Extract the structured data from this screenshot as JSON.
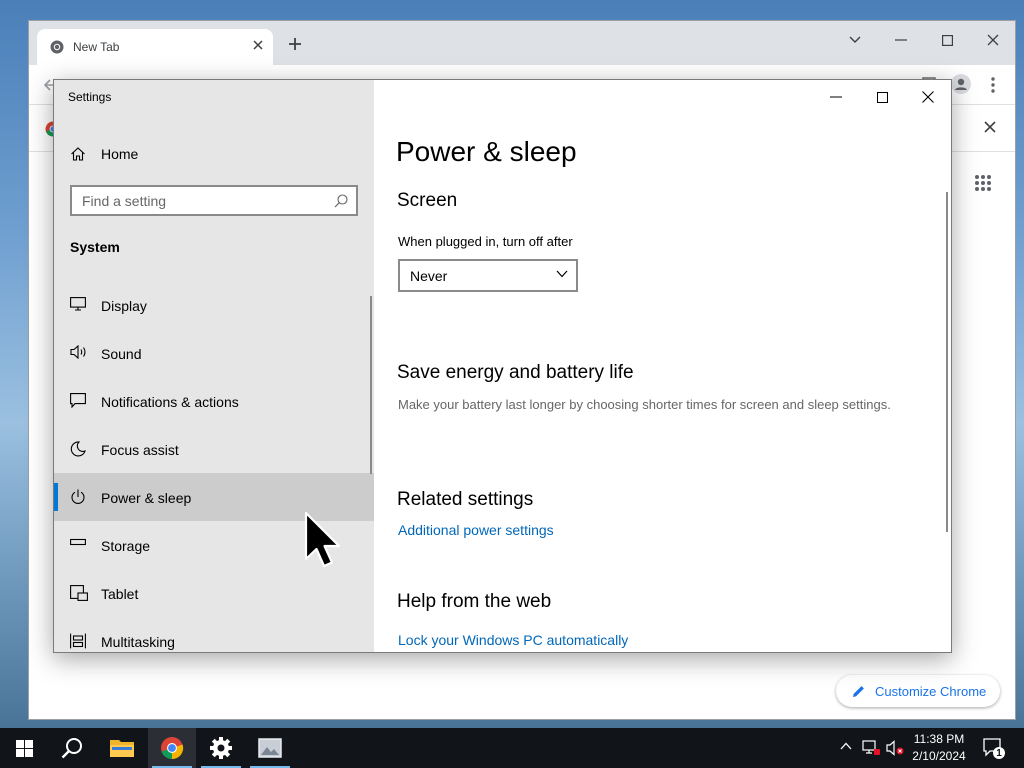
{
  "chrome": {
    "tab_title": "New Tab",
    "customize_label": "Customize Chrome"
  },
  "settings": {
    "window_title": "Settings",
    "home_label": "Home",
    "search_placeholder": "Find a setting",
    "category_heading": "System",
    "nav_items": [
      {
        "label": "Display",
        "icon": "monitor-icon"
      },
      {
        "label": "Sound",
        "icon": "speaker-icon"
      },
      {
        "label": "Notifications & actions",
        "icon": "notification-icon"
      },
      {
        "label": "Focus assist",
        "icon": "moon-icon"
      },
      {
        "label": "Power & sleep",
        "icon": "power-icon",
        "selected": true
      },
      {
        "label": "Storage",
        "icon": "storage-icon"
      },
      {
        "label": "Tablet",
        "icon": "tablet-icon"
      },
      {
        "label": "Multitasking",
        "icon": "multitasking-icon"
      }
    ],
    "page_title": "Power & sleep",
    "screen_heading": "Screen",
    "screen_label": "When plugged in, turn off after",
    "screen_value": "Never",
    "save_energy_heading": "Save energy and battery life",
    "save_energy_desc": "Make your battery last longer by choosing shorter times for screen and sleep settings.",
    "related_heading": "Related settings",
    "related_link": "Additional power settings",
    "help_heading": "Help from the web",
    "help_link": "Lock your Windows PC automatically"
  },
  "taskbar": {
    "time": "11:38 PM",
    "date": "2/10/2024",
    "notification_count": "1"
  },
  "colors": {
    "accent": "#0078d7",
    "link": "#0067b8",
    "chrome_blue": "#1a73e8"
  }
}
